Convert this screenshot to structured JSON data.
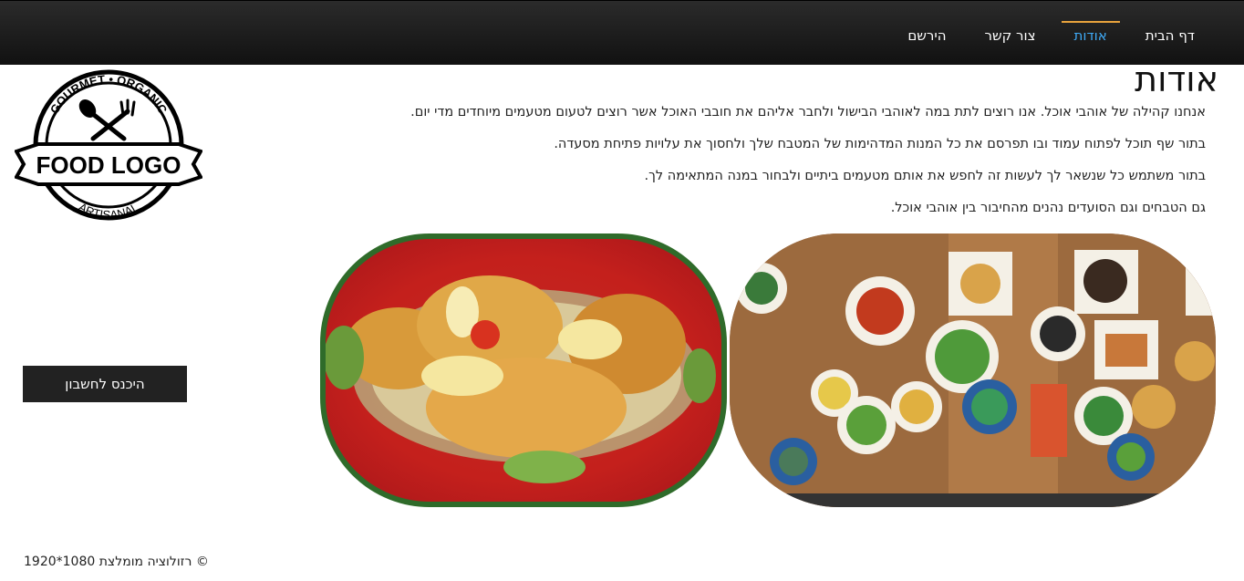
{
  "nav": {
    "items": [
      {
        "label": "דף הבית",
        "active": false
      },
      {
        "label": "אודות",
        "active": true
      },
      {
        "label": "צור קשר",
        "active": false
      },
      {
        "label": "הירשם",
        "active": false
      }
    ],
    "active_color": "#3fa9f5",
    "active_border_color": "#e8a33c"
  },
  "logo": {
    "top_text": "GOURMET • ORGANIC",
    "main_text": "FOOD LOGO",
    "bottom_text": "ARTISANAL",
    "icon": "fork-and-spoon-icon"
  },
  "page": {
    "title": "אודות",
    "paragraphs": [
      "אנחנו קהילה של אוהבי אוכל. אנו רוצים לתת במה לאוהבי הבישול ולחבר אליהם את חובבי האוכל אשר רוצים לטעום מטעמים מיוחדים מדי יום.",
      "בתור שף תוכל לפתוח עמוד ובו תפרסם את כל המנות המדהימות של המטבח שלך ולחסוך את עלויות פתיחת מסעדה.",
      "בתור משתמש כל שנשאר לך לעשות זה לחפש את אותם מטעמים ביתיים ולבחור במנה המתאימה לך.",
      "גם הטבחים וגם הסועדים נהנים מהחיבור בין אוהבי אוכל."
    ]
  },
  "login": {
    "label": "היכנס לחשבון"
  },
  "footer": {
    "note": "© רזולוציה מומלצת 1080*1920"
  }
}
